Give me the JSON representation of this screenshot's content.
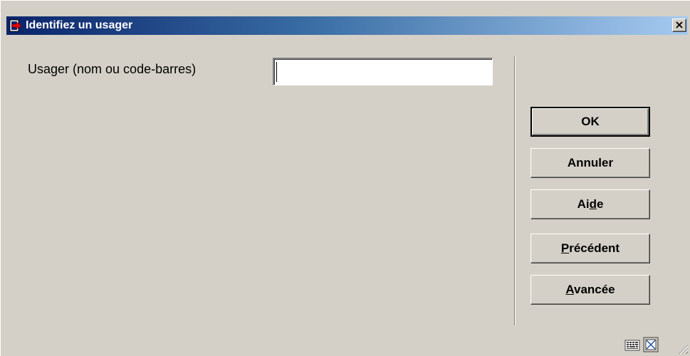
{
  "window": {
    "title": "Identifiez un usager",
    "close_label": "×"
  },
  "form": {
    "field_label": "Usager (nom ou code-barres)",
    "field_value": "",
    "field_placeholder": ""
  },
  "buttons": {
    "ok": "OK",
    "annuler": "Annuler",
    "aide_pre": "Ai",
    "aide_u": "d",
    "aide_post": "e",
    "precedent_u": "P",
    "precedent_post": "récédent",
    "avancee_u": "A",
    "avancee_post": "vancée"
  },
  "status_icons": [
    "keyboard-icon",
    "maximize-icon"
  ],
  "colors": {
    "title_start": "#0a246a",
    "title_end": "#a6caf0",
    "face": "#d4d0c8",
    "icon_red": "#e00000"
  }
}
